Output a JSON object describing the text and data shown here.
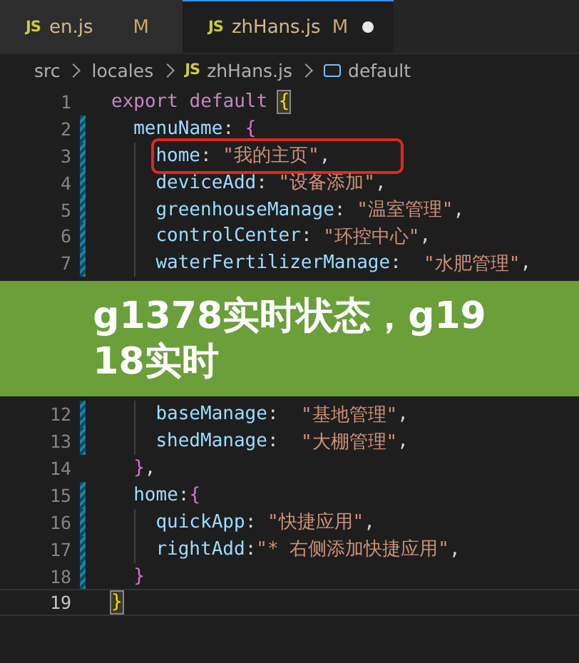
{
  "tabs": [
    {
      "icon": "JS",
      "label": "en.js",
      "status": "M",
      "selected": false,
      "dirty": false
    },
    {
      "icon": "JS",
      "label": "zhHans.js",
      "status": "M",
      "selected": true,
      "dirty": true
    }
  ],
  "breadcrumb": [
    {
      "kind": "folder",
      "text": "src"
    },
    {
      "kind": "folder",
      "text": "locales"
    },
    {
      "kind": "file",
      "icon": "JS",
      "text": "zhHans.js"
    },
    {
      "kind": "symbol",
      "text": "default"
    }
  ],
  "editor": {
    "lines": [
      {
        "kind": "code",
        "number": "1",
        "modified": false,
        "current": false,
        "boxed": false,
        "segments": [
          {
            "kind": "keyword",
            "text": "export default "
          },
          {
            "kind": "brace1",
            "text": "{",
            "matched": true
          }
        ],
        "children": [
          {
            "kind": "code",
            "number": "2",
            "modified": true,
            "current": false,
            "boxed": false,
            "segments": [
              {
                "kind": "key",
                "text": "menuName"
              },
              {
                "kind": "punct",
                "text": ": "
              },
              {
                "kind": "brace2",
                "text": "{",
                "matched": false
              }
            ],
            "children": [
              {
                "kind": "code",
                "number": "3",
                "modified": true,
                "current": false,
                "boxed": true,
                "segments": [
                  {
                    "kind": "key",
                    "text": "home"
                  },
                  {
                    "kind": "punct",
                    "text": ": "
                  },
                  {
                    "kind": "string",
                    "text": "\"我的主页\""
                  },
                  {
                    "kind": "punct",
                    "text": ","
                  }
                ]
              },
              {
                "kind": "code",
                "number": "4",
                "modified": true,
                "current": false,
                "boxed": false,
                "segments": [
                  {
                    "kind": "key",
                    "text": "deviceAdd"
                  },
                  {
                    "kind": "punct",
                    "text": ": "
                  },
                  {
                    "kind": "string",
                    "text": "\"设备添加\""
                  },
                  {
                    "kind": "punct",
                    "text": ","
                  }
                ]
              },
              {
                "kind": "code",
                "number": "5",
                "modified": true,
                "current": false,
                "boxed": false,
                "segments": [
                  {
                    "kind": "key",
                    "text": "greenhouseManage"
                  },
                  {
                    "kind": "punct",
                    "text": ": "
                  },
                  {
                    "kind": "string",
                    "text": "\"温室管理\""
                  },
                  {
                    "kind": "punct",
                    "text": ","
                  }
                ]
              },
              {
                "kind": "code",
                "number": "6",
                "modified": true,
                "current": false,
                "boxed": false,
                "segments": [
                  {
                    "kind": "key",
                    "text": "controlCenter"
                  },
                  {
                    "kind": "punct",
                    "text": ": "
                  },
                  {
                    "kind": "string",
                    "text": "\"环控中心\""
                  },
                  {
                    "kind": "punct",
                    "text": ","
                  }
                ]
              },
              {
                "kind": "code",
                "number": "7",
                "modified": true,
                "current": false,
                "boxed": false,
                "segments": [
                  {
                    "kind": "key",
                    "text": "waterFertilizerManage"
                  },
                  {
                    "kind": "punct",
                    "text": ":  "
                  },
                  {
                    "kind": "string",
                    "text": "\"水肥管理\""
                  },
                  {
                    "kind": "punct",
                    "text": ","
                  }
                ]
              },
              {
                "kind": "banner",
                "lines": [
                  "g1378实时状态，g19",
                  "18实时"
                ]
              },
              {
                "kind": "code",
                "number": "12",
                "modified": true,
                "current": false,
                "boxed": false,
                "segments": [
                  {
                    "kind": "key",
                    "text": "baseManage"
                  },
                  {
                    "kind": "punct",
                    "text": ":  "
                  },
                  {
                    "kind": "string",
                    "text": "\"基地管理\""
                  },
                  {
                    "kind": "punct",
                    "text": ","
                  }
                ]
              },
              {
                "kind": "code",
                "number": "13",
                "modified": true,
                "current": false,
                "boxed": false,
                "segments": [
                  {
                    "kind": "key",
                    "text": "shedManage"
                  },
                  {
                    "kind": "punct",
                    "text": ":  "
                  },
                  {
                    "kind": "string",
                    "text": "\"大棚管理\""
                  },
                  {
                    "kind": "punct",
                    "text": ","
                  }
                ]
              }
            ]
          },
          {
            "kind": "code",
            "number": "14",
            "modified": false,
            "current": false,
            "boxed": false,
            "segments": [
              {
                "kind": "brace2",
                "text": "}",
                "matched": false
              },
              {
                "kind": "punct",
                "text": ","
              }
            ]
          },
          {
            "kind": "code",
            "number": "15",
            "modified": true,
            "current": false,
            "boxed": false,
            "segments": [
              {
                "kind": "key",
                "text": "home"
              },
              {
                "kind": "punct",
                "text": ":"
              },
              {
                "kind": "brace2",
                "text": "{",
                "matched": false
              }
            ],
            "children": [
              {
                "kind": "code",
                "number": "16",
                "modified": true,
                "current": false,
                "boxed": false,
                "segments": [
                  {
                    "kind": "key",
                    "text": "quickApp"
                  },
                  {
                    "kind": "punct",
                    "text": ": "
                  },
                  {
                    "kind": "string",
                    "text": "\"快捷应用\""
                  },
                  {
                    "kind": "punct",
                    "text": ","
                  }
                ]
              },
              {
                "kind": "code",
                "number": "17",
                "modified": true,
                "current": false,
                "boxed": false,
                "segments": [
                  {
                    "kind": "key",
                    "text": "rightAdd"
                  },
                  {
                    "kind": "punct",
                    "text": ":"
                  },
                  {
                    "kind": "string",
                    "text": "\"* 右侧添加快捷应用\""
                  },
                  {
                    "kind": "punct",
                    "text": ","
                  }
                ]
              }
            ]
          },
          {
            "kind": "code",
            "number": "18",
            "modified": true,
            "current": false,
            "boxed": false,
            "segments": [
              {
                "kind": "brace2",
                "text": "}",
                "matched": false
              }
            ]
          }
        ]
      },
      {
        "kind": "code",
        "number": "19",
        "modified": false,
        "current": true,
        "boxed": false,
        "segments": [
          {
            "kind": "brace1",
            "text": "}",
            "matched": true
          }
        ]
      }
    ]
  }
}
